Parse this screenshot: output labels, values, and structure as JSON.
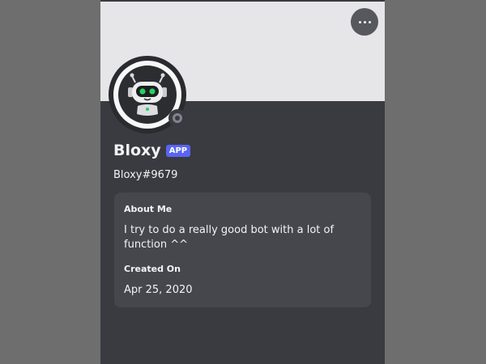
{
  "profile": {
    "display_name": "Bloxy",
    "badge": "APP",
    "username": "Bloxy#9679",
    "status": "offline",
    "banner_color": "#e6e6e9",
    "avatar_icon": "robot-icon"
  },
  "more_button": {
    "icon": "more-horizontal-icon"
  },
  "about": {
    "title": "About Me",
    "text": "I try to do a really good bot with a lot of function ^^"
  },
  "created": {
    "title": "Created On",
    "date": "Apr 25, 2020"
  },
  "colors": {
    "card_background": "#3a3b40",
    "app_badge": "#5865f2",
    "robot_eyes": "#23d160"
  }
}
